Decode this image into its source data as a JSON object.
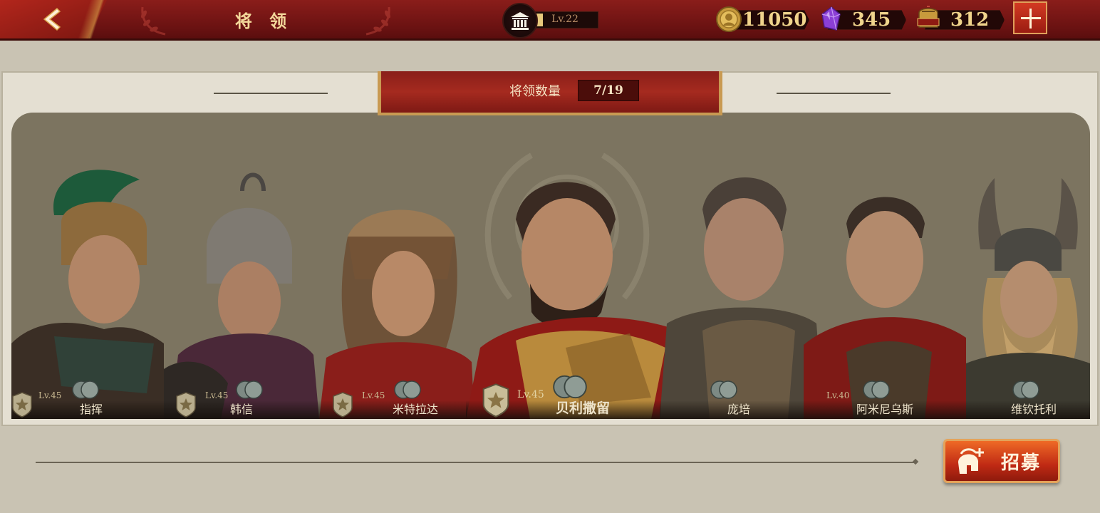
{
  "header": {
    "title": "将 领",
    "level_label": "Lv.22",
    "level_progress": 0.15,
    "gold": "11050",
    "gems": "345",
    "spqr_tokens": "312"
  },
  "panel": {
    "count_label": "将领数量",
    "count_value": "7/19"
  },
  "generals": [
    {
      "name": "指挥",
      "level": "Lv.45"
    },
    {
      "name": "韩信",
      "level": "Lv.45"
    },
    {
      "name": "米特拉达",
      "level": "Lv.45"
    },
    {
      "name": "贝利撒留",
      "level": "Lv.45",
      "featured": true
    },
    {
      "name": "庞培",
      "level": ""
    },
    {
      "name": "阿米尼乌斯",
      "level": "Lv.40"
    },
    {
      "name": "维钦托利",
      "level": ""
    }
  ],
  "recruit": {
    "label": "招募"
  },
  "icons": {
    "back": "back-chevron-icon",
    "building": "temple-icon",
    "gold": "gold-coin-icon",
    "gem": "purple-gem-icon",
    "spqr": "spqr-helmet-icon",
    "plus": "plus-icon"
  },
  "colors": {
    "topbar": "#7a1812",
    "accent_gold": "#f0d48c",
    "panel_bg": "#7c7460",
    "button_red": "#c02a14"
  }
}
